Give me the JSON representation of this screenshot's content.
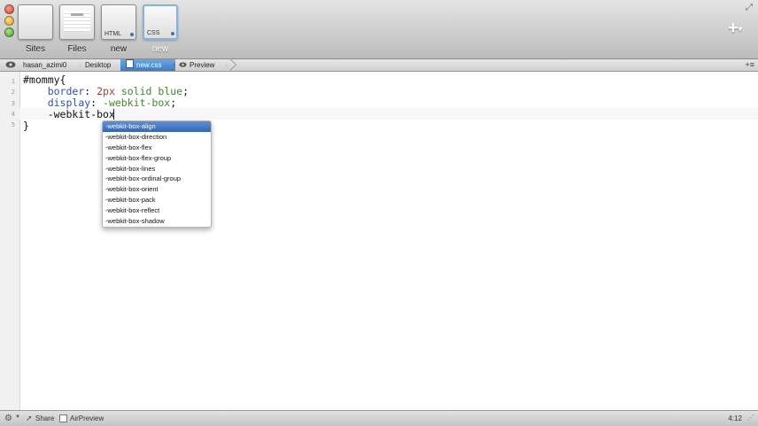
{
  "toolbar": {
    "items": [
      {
        "label": "Sites",
        "thumb_title": ""
      },
      {
        "label": "Files",
        "thumb_title": ""
      },
      {
        "label": "new",
        "thumb_title": "HTML"
      },
      {
        "label": "new",
        "thumb_title": "CSS"
      }
    ],
    "active_index": 3,
    "add_button": "+"
  },
  "pathbar": {
    "crumbs": [
      "hasan_azimi0",
      "Desktop",
      "new.css"
    ],
    "preview_label": "Preview"
  },
  "editor": {
    "line_numbers": [
      "1",
      "2",
      "3",
      "4",
      "5"
    ],
    "lines": [
      {
        "a": "#mommy{"
      },
      {
        "a": "    ",
        "prop": "border",
        "sep": ": ",
        "num": "2px",
        "val": " solid blue",
        "end": ";"
      },
      {
        "a": "    ",
        "prop": "display",
        "sep": ": ",
        "val": "-webkit-box",
        "end": ";"
      },
      {
        "a": "    -webkit-box"
      },
      {
        "a": "}"
      }
    ]
  },
  "autocomplete": {
    "selected_index": 0,
    "items": [
      "-webkit-box-align",
      "-webkit-box-direction",
      "-webkit-box-flex",
      "-webkit-box-flex-group",
      "-webkit-box-lines",
      "-webkit-box-ordinal-group",
      "-webkit-box-orient",
      "-webkit-box-pack",
      "-webkit-box-reflect",
      "-webkit-box-shadow"
    ]
  },
  "statusbar": {
    "share_label": "Share",
    "airpreview_label": "AirPreview",
    "position": "4:12"
  },
  "colors": {
    "property": "#2a55b0",
    "number": "#c0342a",
    "value": "#3f8a2c",
    "selection": "#3367b8"
  }
}
